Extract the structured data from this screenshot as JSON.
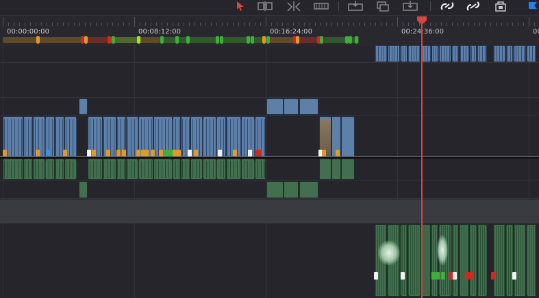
{
  "timecodes": [
    "00:00:00:00",
    "00:08:12:00",
    "00:16:24:00",
    "00:24:36:00",
    "00:"
  ],
  "colors": {
    "video_clip": "#5d7fa8",
    "audio_clip": "#436e50",
    "playhead": "#d4473e",
    "marker_orange": "#e09a2a",
    "marker_green": "#3fae3a",
    "marker_red": "#cc2a1e",
    "marker_blue": "#3a8fe0",
    "marker_white": "#f2f2f2",
    "flag_blue": "#2a7fe0"
  },
  "toolbar": {
    "icons": [
      "selection-arrow-icon",
      "insert-clip-icon",
      "trim-clip-icon",
      "blade-icon",
      "overwrite-icon",
      "replace-clip-icon",
      "place-on-top-icon",
      "snapping-icon",
      "linked-selection-icon",
      "position-lock-icon",
      "flag-icon"
    ]
  }
}
